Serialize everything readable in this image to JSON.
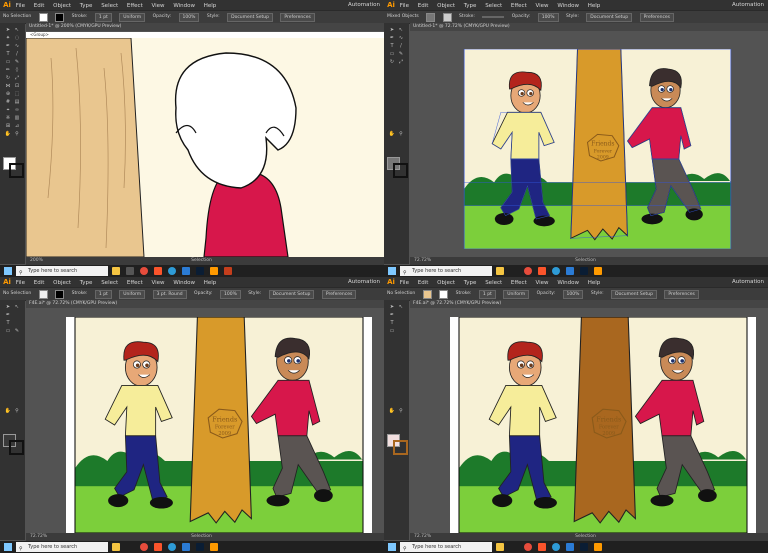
{
  "menu": [
    "File",
    "Edit",
    "Object",
    "Type",
    "Select",
    "Effect",
    "View",
    "Window",
    "Help"
  ],
  "workspace": "Automation",
  "app_logo": "Ai",
  "windows": [
    {
      "id": "tl",
      "control": [
        "No Selection",
        "Stroke:",
        "1 pt",
        "Uniform",
        "Opacity:",
        "100%",
        "Style:",
        "Document Setup",
        "Preferences"
      ],
      "doc_tab": "Untitled-1* @ 200% (CMYK/GPU Preview)",
      "breadcrumb": "<Group>",
      "zoom": "200%",
      "status": "Selection"
    },
    {
      "id": "tr",
      "control": [
        "Mixed Objects",
        "Stroke:",
        "Opacity:",
        "100%",
        "Style:",
        "Document Setup",
        "Preferences"
      ],
      "doc_tab": "Untitled-1* @ 72.72% (CMYK/GPU Preview)",
      "zoom": "72.72%",
      "status": "Selection",
      "badge": "Friends Forever 2009"
    },
    {
      "id": "bl",
      "control": [
        "No Selection",
        "Stroke:",
        "1 pt",
        "Uniform",
        "3 pt. Round",
        "Opacity:",
        "100%",
        "Style:",
        "Document Setup",
        "Preferences"
      ],
      "doc_tab": "F4E.ai* @ 72.72% (CMYK/GPU Preview)",
      "zoom": "72.72%",
      "status": "Selection",
      "badge": "Friends Forever 2009"
    },
    {
      "id": "br",
      "control": [
        "No Selection",
        "Stroke:",
        "1 pt",
        "Uniform",
        "Opacity:",
        "100%",
        "Style:",
        "Document Setup",
        "Preferences"
      ],
      "doc_tab": "F4E.ai* @ 72.72% (CMYK/GPU Preview)",
      "zoom": "72.72%",
      "status": "Selection",
      "badge": "Friends Forever 2009"
    }
  ],
  "taskbar": {
    "search_placeholder": "Type here to search"
  },
  "colors": {
    "ui_dark": "#323232",
    "ui_mid": "#535353",
    "accent": "#ff9a00",
    "shirt_yellow": "#f6ed9a",
    "shirt_red": "#d7174b",
    "pants_blue": "#1f2582",
    "pants_gray": "#5a5452",
    "tree_tan": "#e9c68f",
    "tree_orange": "#d89a2a",
    "tree_brown": "#a9671f",
    "grass": "#7ccf3b",
    "bushes": "#1d7a2a",
    "sky": "#f7f1d6",
    "hair_red": "#b3241c",
    "hair_dark": "#3a2e2e"
  }
}
